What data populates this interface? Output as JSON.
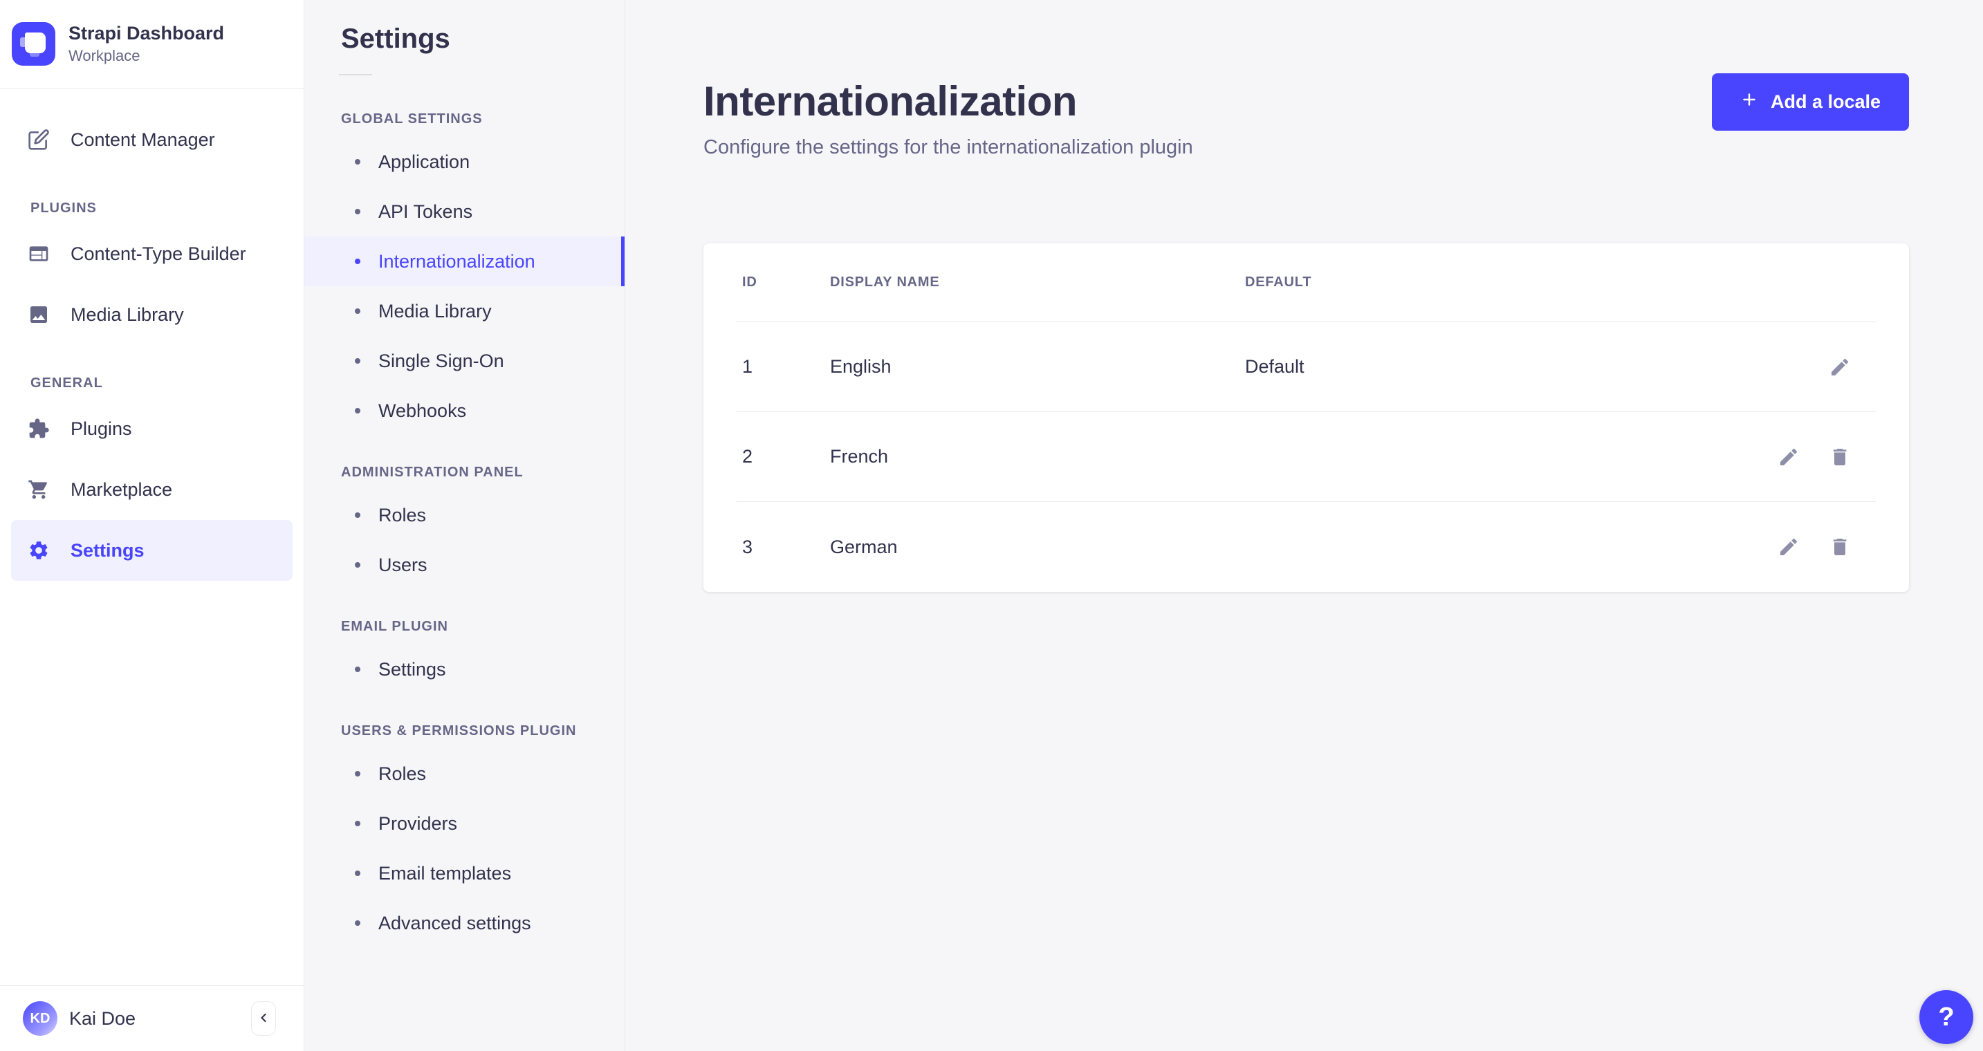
{
  "app": {
    "brand": {
      "title": "Strapi Dashboard",
      "subtitle": "Workplace"
    },
    "colors": {
      "primary": "#4945ff",
      "selected_bg": "#f0f0ff",
      "background": "#f6f6f9",
      "surface": "#ffffff",
      "border": "#eaeaef",
      "text_dark": "#32324d",
      "text_muted": "#666687",
      "icon_muted": "#8e8ea9"
    }
  },
  "sidebar": {
    "items_top": [
      {
        "label": "Content Manager",
        "icon": "content-manager-icon"
      }
    ],
    "sections": [
      {
        "label": "PLUGINS",
        "items": [
          {
            "label": "Content-Type Builder",
            "icon": "content-type-builder-icon"
          },
          {
            "label": "Media Library",
            "icon": "media-library-icon"
          }
        ]
      },
      {
        "label": "GENERAL",
        "items": [
          {
            "label": "Plugins",
            "icon": "puzzle-icon"
          },
          {
            "label": "Marketplace",
            "icon": "cart-icon"
          },
          {
            "label": "Settings",
            "icon": "gear-icon",
            "selected": true
          }
        ]
      }
    ],
    "user": {
      "initials": "KD",
      "name": "Kai Doe"
    },
    "collapse_icon": "chevron-left-icon"
  },
  "subnav": {
    "title": "Settings",
    "sections": [
      {
        "label": "GLOBAL SETTINGS",
        "items": [
          {
            "label": "Application"
          },
          {
            "label": "API Tokens"
          },
          {
            "label": "Internationalization",
            "selected": true
          },
          {
            "label": "Media Library"
          },
          {
            "label": "Single Sign-On"
          },
          {
            "label": "Webhooks"
          }
        ]
      },
      {
        "label": "ADMINISTRATION PANEL",
        "items": [
          {
            "label": "Roles"
          },
          {
            "label": "Users"
          }
        ]
      },
      {
        "label": "EMAIL PLUGIN",
        "items": [
          {
            "label": "Settings"
          }
        ]
      },
      {
        "label": "USERS & PERMISSIONS PLUGIN",
        "items": [
          {
            "label": "Roles"
          },
          {
            "label": "Providers"
          },
          {
            "label": "Email templates"
          },
          {
            "label": "Advanced settings"
          }
        ]
      }
    ]
  },
  "main": {
    "title": "Internationalization",
    "subtitle": "Configure the settings for the internationalization plugin",
    "add_button_label": "Add a locale",
    "add_button_icon": "plus-icon",
    "help_label": "?",
    "table": {
      "headers": [
        "ID",
        "DISPLAY NAME",
        "DEFAULT"
      ],
      "rows": [
        {
          "id": "1",
          "display_name": "English",
          "default": "Default",
          "actions": [
            "edit"
          ]
        },
        {
          "id": "2",
          "display_name": "French",
          "default": "",
          "actions": [
            "edit",
            "delete"
          ]
        },
        {
          "id": "3",
          "display_name": "German",
          "default": "",
          "actions": [
            "edit",
            "delete"
          ]
        }
      ]
    }
  }
}
